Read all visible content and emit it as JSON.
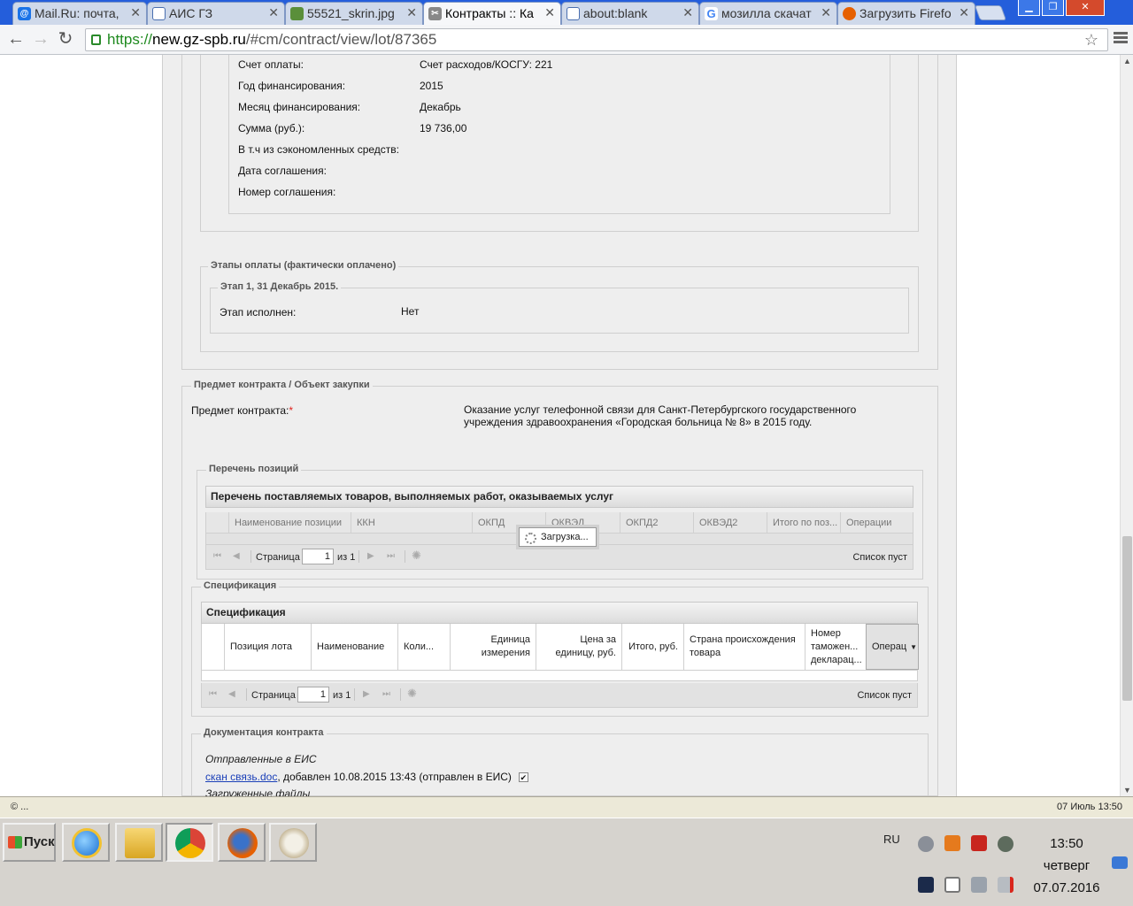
{
  "browser": {
    "tabs": [
      {
        "title": "Mail.Ru: почта,",
        "icon": "mail-ru-icon",
        "color": "#1a73e8"
      },
      {
        "title": "АИС ГЗ",
        "icon": "document-icon",
        "color": "#4a6fb0"
      },
      {
        "title": "55521_skrin.jpg",
        "icon": "image-icon",
        "color": "#5a8f3a"
      },
      {
        "title": "Контракты :: Ка",
        "icon": "tools-icon",
        "color": "#777"
      },
      {
        "title": "about:blank",
        "icon": "document-icon",
        "color": "#4a6fb0"
      },
      {
        "title": "мозилла скачат",
        "icon": "google-icon",
        "color": "#4285f4"
      },
      {
        "title": "Загрузить Firefo",
        "icon": "firefox-icon",
        "color": "#e66000"
      }
    ],
    "url_scheme": "https://",
    "url_host": "new.gz-spb.ru",
    "url_path": "/#cm/contract/view/lot/87365"
  },
  "finance": {
    "rows": [
      {
        "label": "Счет оплаты:",
        "value": "Счет расходов/КОСГУ: 221"
      },
      {
        "label": "Год финансирования:",
        "value": "2015"
      },
      {
        "label": "Месяц финансирования:",
        "value": "Декабрь"
      },
      {
        "label": "Сумма (руб.):",
        "value": "19 736,00"
      },
      {
        "label": "В т.ч из сэкономленных средств:",
        "value": ""
      },
      {
        "label": "Дата соглашения:",
        "value": ""
      },
      {
        "label": "Номер соглашения:",
        "value": ""
      }
    ]
  },
  "payments": {
    "legend": "Этапы оплаты (фактически оплачено)",
    "stage_legend": "Этап 1, 31 Декабрь 2015.",
    "stage_label": "Этап исполнен:",
    "stage_value": "Нет"
  },
  "subject": {
    "legend": "Предмет контракта / Объект закупки",
    "label": "Предмет контракта:",
    "required_mark": "*",
    "value_line1": "Оказание услуг телефонной связи для Санкт-Петербургского государственного",
    "value_line2": "учреждения здравоохранения «Городская больница № 8» в 2015 году."
  },
  "positions": {
    "legend": "Перечень позиций",
    "grid_title": "Перечень поставляемых товаров, выполняемых работ, оказываемых услуг",
    "columns": [
      "Наименование позиции",
      "ККН",
      "ОКПД",
      "ОКВЭД",
      "ОКПД2",
      "ОКВЭД2",
      "Итого по поз...",
      "Операции"
    ],
    "loading": "Загрузка...",
    "pager": {
      "page_label": "Страница",
      "page": "1",
      "of": "из 1",
      "empty": "Список пуст"
    }
  },
  "spec": {
    "legend": "Спецификация",
    "grid_title": "Спецификация",
    "columns": [
      "Позиция лота",
      "Наименование",
      "Коли...",
      "Единица измерения",
      "Цена за единицу, руб.",
      "Итого, руб.",
      "Страна происхождения товара",
      "Номер таможен... декларац...",
      "Операц"
    ],
    "pager": {
      "page_label": "Страница",
      "page": "1",
      "of": "из 1",
      "empty": "Список пуст"
    }
  },
  "docs": {
    "legend": "Документация контракта",
    "sent_heading": "Отправленные в ЕИС",
    "file_link": "скан связь.doc",
    "file_info": ", добавлен 10.08.2015 13:43 (отправлен в ЕИС)",
    "uploaded_heading": "Загруженные файлы"
  },
  "statusbar": {
    "left": "© ...",
    "right": "07 Июль 13:50"
  },
  "taskbar": {
    "start": "Пуск",
    "lang": "RU",
    "time": "13:50",
    "weekday": "четверг",
    "date": "07.07.2016"
  }
}
